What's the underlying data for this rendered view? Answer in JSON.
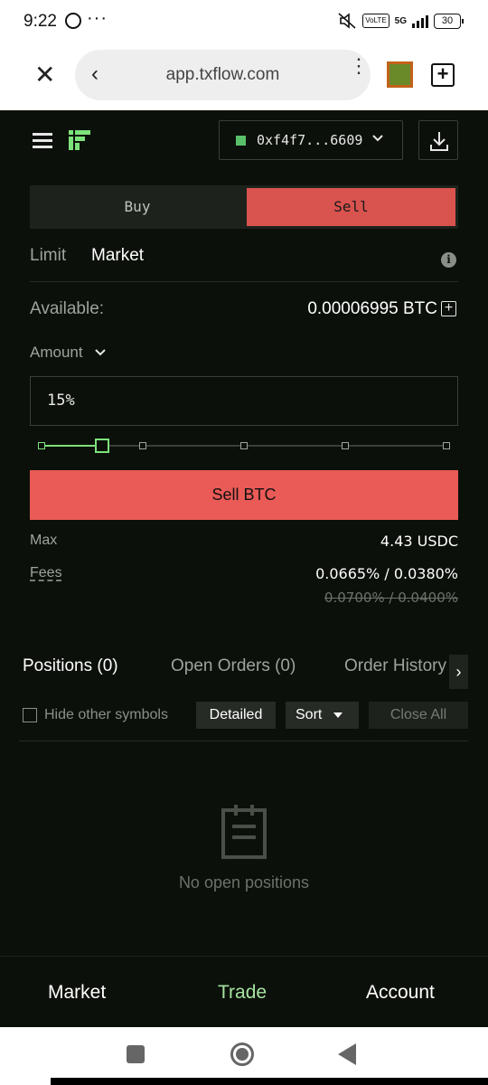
{
  "status_bar": {
    "time": "9:22",
    "dots": "···",
    "network": "5G",
    "volte": "VoLTE",
    "battery": "30"
  },
  "browser": {
    "url": "app.txflow.com",
    "close_icon": "close-icon",
    "back_icon": "back-arrow-icon",
    "menu_icon": "more-vert-icon",
    "new_tab_icon": "new-tab-icon"
  },
  "header": {
    "wallet_address": "0xf4f7...6609",
    "wallet_color": "#59c06a",
    "menu_icon": "hamburger-icon",
    "download_icon": "download-icon"
  },
  "side_toggle": {
    "buy_label": "Buy",
    "sell_label": "Sell",
    "selected": "Sell",
    "sell_color": "#d9534f"
  },
  "order_types": {
    "limit_label": "Limit",
    "market_label": "Market",
    "selected": "Market"
  },
  "available": {
    "label": "Available:",
    "value": "0.00006995 BTC"
  },
  "amount": {
    "label": "Amount",
    "input_value": "15%",
    "slider_percent": 15,
    "slider_marks": [
      0,
      15,
      25,
      50,
      75,
      100
    ],
    "accent_color": "#7de27b"
  },
  "action": {
    "sell_button": "Sell BTC",
    "button_color": "#ea5a56"
  },
  "summary": {
    "max_label": "Max",
    "max_value": "4.43 USDC",
    "fees_label": "Fees",
    "fees_value": "0.0665% / 0.0380%",
    "fees_old_value": "0.0700% / 0.0400%"
  },
  "tabs": {
    "items": [
      "Positions (0)",
      "Open Orders (0)",
      "Order History"
    ],
    "active": "Positions (0)",
    "scroll_glyph": "›"
  },
  "filters": {
    "hide_label": "Hide other symbols",
    "hide_checked": false,
    "detailed_label": "Detailed",
    "sort_label": "Sort",
    "close_all_label": "Close All"
  },
  "empty_state": {
    "icon": "clipboard-icon",
    "text": "No open positions"
  },
  "bottom_nav": {
    "items": [
      "Market",
      "Trade",
      "Account"
    ],
    "active": "Trade",
    "active_color": "#a6e3a1"
  }
}
